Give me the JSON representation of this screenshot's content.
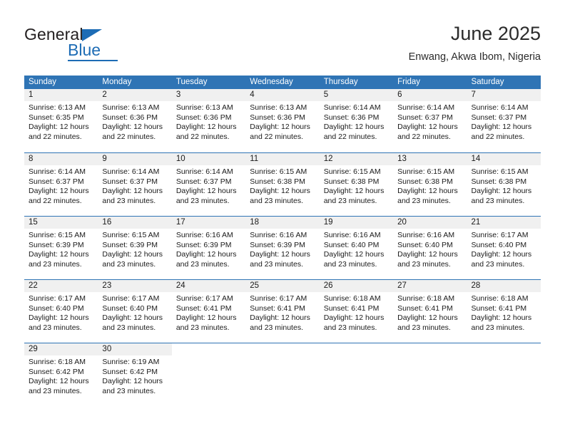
{
  "brand": {
    "name_part1": "General",
    "name_part2": "Blue"
  },
  "header": {
    "title": "June 2025",
    "subtitle": "Enwang, Akwa Ibom, Nigeria"
  },
  "weekdays": [
    "Sunday",
    "Monday",
    "Tuesday",
    "Wednesday",
    "Thursday",
    "Friday",
    "Saturday"
  ],
  "colors": {
    "header_blue": "#2f74b5",
    "brand_blue": "#1d6cb5",
    "day_band_gray": "#f0f0f0"
  },
  "weeks": [
    [
      {
        "day": "1",
        "sunrise": "Sunrise: 6:13 AM",
        "sunset": "Sunset: 6:35 PM",
        "daylight_1": "Daylight: 12 hours",
        "daylight_2": "and 22 minutes."
      },
      {
        "day": "2",
        "sunrise": "Sunrise: 6:13 AM",
        "sunset": "Sunset: 6:36 PM",
        "daylight_1": "Daylight: 12 hours",
        "daylight_2": "and 22 minutes."
      },
      {
        "day": "3",
        "sunrise": "Sunrise: 6:13 AM",
        "sunset": "Sunset: 6:36 PM",
        "daylight_1": "Daylight: 12 hours",
        "daylight_2": "and 22 minutes."
      },
      {
        "day": "4",
        "sunrise": "Sunrise: 6:13 AM",
        "sunset": "Sunset: 6:36 PM",
        "daylight_1": "Daylight: 12 hours",
        "daylight_2": "and 22 minutes."
      },
      {
        "day": "5",
        "sunrise": "Sunrise: 6:14 AM",
        "sunset": "Sunset: 6:36 PM",
        "daylight_1": "Daylight: 12 hours",
        "daylight_2": "and 22 minutes."
      },
      {
        "day": "6",
        "sunrise": "Sunrise: 6:14 AM",
        "sunset": "Sunset: 6:37 PM",
        "daylight_1": "Daylight: 12 hours",
        "daylight_2": "and 22 minutes."
      },
      {
        "day": "7",
        "sunrise": "Sunrise: 6:14 AM",
        "sunset": "Sunset: 6:37 PM",
        "daylight_1": "Daylight: 12 hours",
        "daylight_2": "and 22 minutes."
      }
    ],
    [
      {
        "day": "8",
        "sunrise": "Sunrise: 6:14 AM",
        "sunset": "Sunset: 6:37 PM",
        "daylight_1": "Daylight: 12 hours",
        "daylight_2": "and 22 minutes."
      },
      {
        "day": "9",
        "sunrise": "Sunrise: 6:14 AM",
        "sunset": "Sunset: 6:37 PM",
        "daylight_1": "Daylight: 12 hours",
        "daylight_2": "and 23 minutes."
      },
      {
        "day": "10",
        "sunrise": "Sunrise: 6:14 AM",
        "sunset": "Sunset: 6:37 PM",
        "daylight_1": "Daylight: 12 hours",
        "daylight_2": "and 23 minutes."
      },
      {
        "day": "11",
        "sunrise": "Sunrise: 6:15 AM",
        "sunset": "Sunset: 6:38 PM",
        "daylight_1": "Daylight: 12 hours",
        "daylight_2": "and 23 minutes."
      },
      {
        "day": "12",
        "sunrise": "Sunrise: 6:15 AM",
        "sunset": "Sunset: 6:38 PM",
        "daylight_1": "Daylight: 12 hours",
        "daylight_2": "and 23 minutes."
      },
      {
        "day": "13",
        "sunrise": "Sunrise: 6:15 AM",
        "sunset": "Sunset: 6:38 PM",
        "daylight_1": "Daylight: 12 hours",
        "daylight_2": "and 23 minutes."
      },
      {
        "day": "14",
        "sunrise": "Sunrise: 6:15 AM",
        "sunset": "Sunset: 6:38 PM",
        "daylight_1": "Daylight: 12 hours",
        "daylight_2": "and 23 minutes."
      }
    ],
    [
      {
        "day": "15",
        "sunrise": "Sunrise: 6:15 AM",
        "sunset": "Sunset: 6:39 PM",
        "daylight_1": "Daylight: 12 hours",
        "daylight_2": "and 23 minutes."
      },
      {
        "day": "16",
        "sunrise": "Sunrise: 6:15 AM",
        "sunset": "Sunset: 6:39 PM",
        "daylight_1": "Daylight: 12 hours",
        "daylight_2": "and 23 minutes."
      },
      {
        "day": "17",
        "sunrise": "Sunrise: 6:16 AM",
        "sunset": "Sunset: 6:39 PM",
        "daylight_1": "Daylight: 12 hours",
        "daylight_2": "and 23 minutes."
      },
      {
        "day": "18",
        "sunrise": "Sunrise: 6:16 AM",
        "sunset": "Sunset: 6:39 PM",
        "daylight_1": "Daylight: 12 hours",
        "daylight_2": "and 23 minutes."
      },
      {
        "day": "19",
        "sunrise": "Sunrise: 6:16 AM",
        "sunset": "Sunset: 6:40 PM",
        "daylight_1": "Daylight: 12 hours",
        "daylight_2": "and 23 minutes."
      },
      {
        "day": "20",
        "sunrise": "Sunrise: 6:16 AM",
        "sunset": "Sunset: 6:40 PM",
        "daylight_1": "Daylight: 12 hours",
        "daylight_2": "and 23 minutes."
      },
      {
        "day": "21",
        "sunrise": "Sunrise: 6:17 AM",
        "sunset": "Sunset: 6:40 PM",
        "daylight_1": "Daylight: 12 hours",
        "daylight_2": "and 23 minutes."
      }
    ],
    [
      {
        "day": "22",
        "sunrise": "Sunrise: 6:17 AM",
        "sunset": "Sunset: 6:40 PM",
        "daylight_1": "Daylight: 12 hours",
        "daylight_2": "and 23 minutes."
      },
      {
        "day": "23",
        "sunrise": "Sunrise: 6:17 AM",
        "sunset": "Sunset: 6:40 PM",
        "daylight_1": "Daylight: 12 hours",
        "daylight_2": "and 23 minutes."
      },
      {
        "day": "24",
        "sunrise": "Sunrise: 6:17 AM",
        "sunset": "Sunset: 6:41 PM",
        "daylight_1": "Daylight: 12 hours",
        "daylight_2": "and 23 minutes."
      },
      {
        "day": "25",
        "sunrise": "Sunrise: 6:17 AM",
        "sunset": "Sunset: 6:41 PM",
        "daylight_1": "Daylight: 12 hours",
        "daylight_2": "and 23 minutes."
      },
      {
        "day": "26",
        "sunrise": "Sunrise: 6:18 AM",
        "sunset": "Sunset: 6:41 PM",
        "daylight_1": "Daylight: 12 hours",
        "daylight_2": "and 23 minutes."
      },
      {
        "day": "27",
        "sunrise": "Sunrise: 6:18 AM",
        "sunset": "Sunset: 6:41 PM",
        "daylight_1": "Daylight: 12 hours",
        "daylight_2": "and 23 minutes."
      },
      {
        "day": "28",
        "sunrise": "Sunrise: 6:18 AM",
        "sunset": "Sunset: 6:41 PM",
        "daylight_1": "Daylight: 12 hours",
        "daylight_2": "and 23 minutes."
      }
    ],
    [
      {
        "day": "29",
        "sunrise": "Sunrise: 6:18 AM",
        "sunset": "Sunset: 6:42 PM",
        "daylight_1": "Daylight: 12 hours",
        "daylight_2": "and 23 minutes."
      },
      {
        "day": "30",
        "sunrise": "Sunrise: 6:19 AM",
        "sunset": "Sunset: 6:42 PM",
        "daylight_1": "Daylight: 12 hours",
        "daylight_2": "and 23 minutes."
      },
      {
        "day": "",
        "sunrise": "",
        "sunset": "",
        "daylight_1": "",
        "daylight_2": ""
      },
      {
        "day": "",
        "sunrise": "",
        "sunset": "",
        "daylight_1": "",
        "daylight_2": ""
      },
      {
        "day": "",
        "sunrise": "",
        "sunset": "",
        "daylight_1": "",
        "daylight_2": ""
      },
      {
        "day": "",
        "sunrise": "",
        "sunset": "",
        "daylight_1": "",
        "daylight_2": ""
      },
      {
        "day": "",
        "sunrise": "",
        "sunset": "",
        "daylight_1": "",
        "daylight_2": ""
      }
    ]
  ]
}
